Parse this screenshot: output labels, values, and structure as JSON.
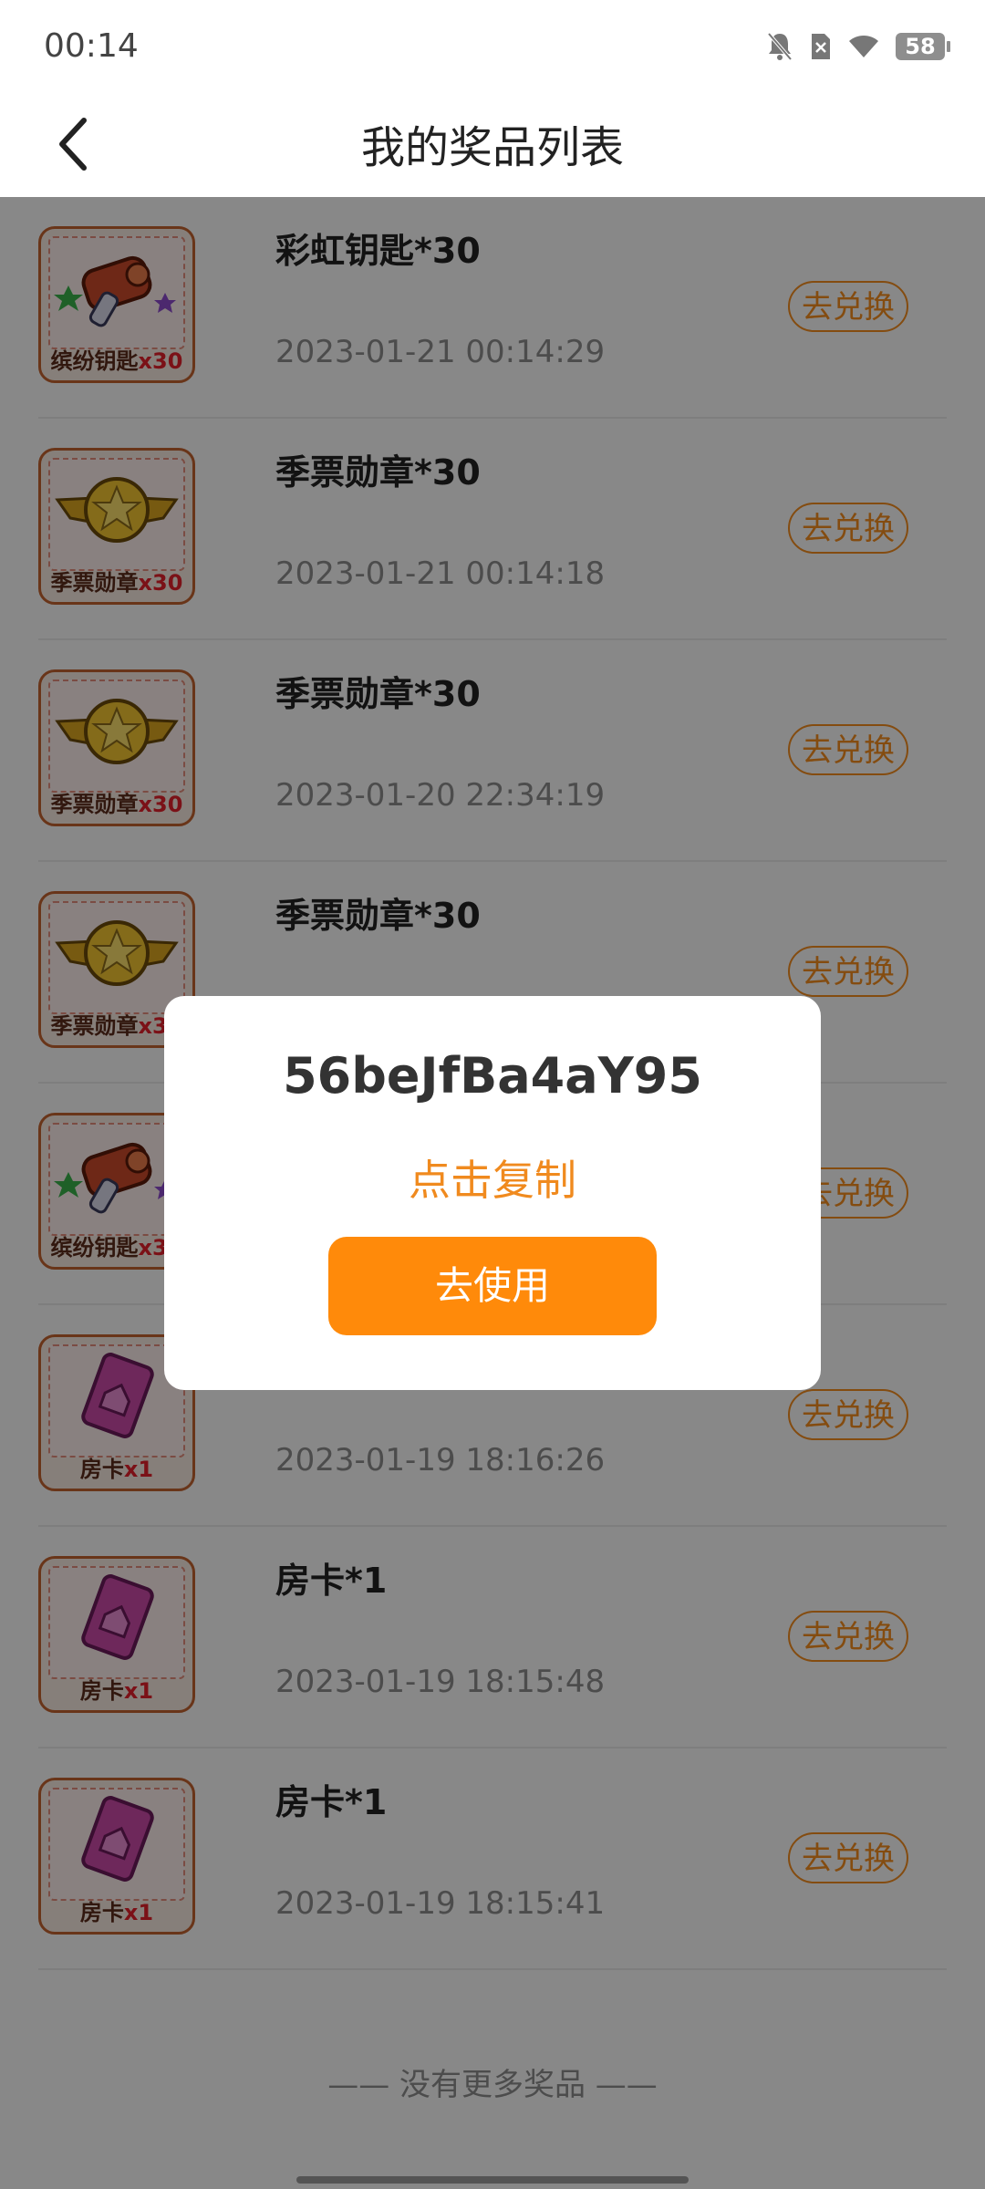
{
  "status_bar": {
    "time": "00:14",
    "battery": "58"
  },
  "header": {
    "title": "我的奖品列表"
  },
  "prizes": [
    {
      "title": "彩虹钥匙*30",
      "time": "2023-01-21 00:14:29",
      "action": "去兑换",
      "thumb_label": "缤纷钥匙",
      "thumb_qty": "x30",
      "icon": "rainbow-key"
    },
    {
      "title": "季票勋章*30",
      "time": "2023-01-21 00:14:18",
      "action": "去兑换",
      "thumb_label": "季票勋章",
      "thumb_qty": "x30",
      "icon": "season-medal"
    },
    {
      "title": "季票勋章*30",
      "time": "2023-01-20 22:34:19",
      "action": "去兑换",
      "thumb_label": "季票勋章",
      "thumb_qty": "x30",
      "icon": "season-medal"
    },
    {
      "title": "季票勋章*30",
      "time": "",
      "action": "去兑换",
      "thumb_label": "季票勋章",
      "thumb_qty": "x30",
      "icon": "season-medal"
    },
    {
      "title": "",
      "time": "",
      "action": "去兑换",
      "thumb_label": "缤纷钥匙",
      "thumb_qty": "x30",
      "icon": "rainbow-key"
    },
    {
      "title": "",
      "time": "2023-01-19 18:16:26",
      "action": "去兑换",
      "thumb_label": "房卡",
      "thumb_qty": "x1",
      "icon": "room-card"
    },
    {
      "title": "房卡*1",
      "time": "2023-01-19 18:15:48",
      "action": "去兑换",
      "thumb_label": "房卡",
      "thumb_qty": "x1",
      "icon": "room-card"
    },
    {
      "title": "房卡*1",
      "time": "2023-01-19 18:15:41",
      "action": "去兑换",
      "thumb_label": "房卡",
      "thumb_qty": "x1",
      "icon": "room-card"
    }
  ],
  "footer": {
    "no_more": "—— 没有更多奖品 ——"
  },
  "dialog": {
    "code": "56beJfBa4aY95",
    "copy_label": "点击复制",
    "use_label": "去使用"
  },
  "colors": {
    "accent": "#ff8a0a",
    "accent_text": "#f08a1e",
    "overlay": "rgba(0,0,0,0.45)"
  }
}
